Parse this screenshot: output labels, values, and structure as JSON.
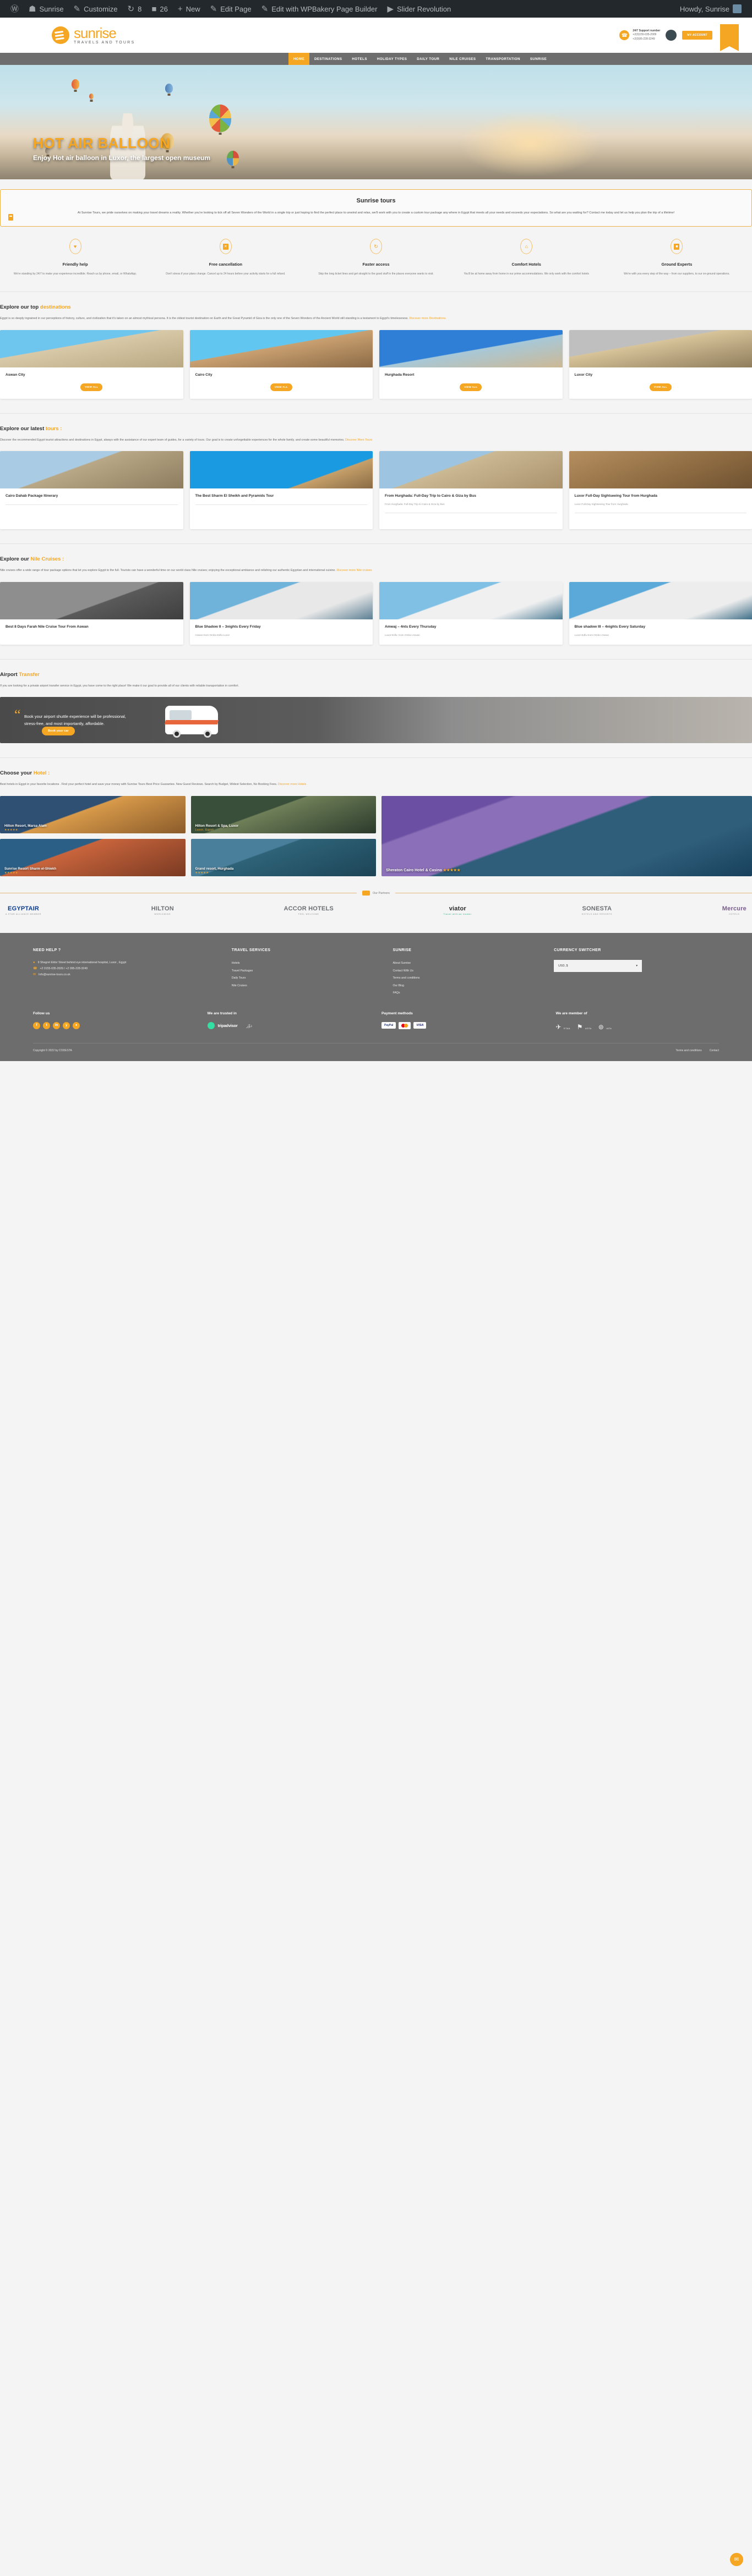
{
  "adminbar": {
    "items": [
      {
        "icon": "wordpress-icon",
        "glyph": "Ⓦ",
        "label": ""
      },
      {
        "icon": "dashboard-icon",
        "glyph": "☗",
        "label": "Sunrise"
      },
      {
        "icon": "customize-icon",
        "glyph": "✎",
        "label": "Customize"
      },
      {
        "icon": "updates-icon",
        "glyph": "↻",
        "label": "8"
      },
      {
        "icon": "comments-icon",
        "glyph": "■",
        "label": "26"
      },
      {
        "icon": "new-icon",
        "glyph": "+",
        "label": "New"
      },
      {
        "icon": "edit-page-icon",
        "glyph": "✎",
        "label": "Edit Page"
      },
      {
        "icon": "wpbakery-icon",
        "glyph": "✎",
        "label": "Edit with WPBakery Page Builder"
      },
      {
        "icon": "slider-revolution-icon",
        "glyph": "▶",
        "label": "Slider Revolution"
      }
    ],
    "howdy": "Howdy, Sunrise"
  },
  "header": {
    "logo_name": "sunrise",
    "logo_tagline": "TRAVELS AND TOURS",
    "support_label": "24/7 Support number",
    "phone1": "+2(0)155-035-2009",
    "phone2": "+2(0)95-228-3249",
    "account_button": "MY ACCOUNT"
  },
  "nav": {
    "items": [
      {
        "label": "HOME",
        "active": true
      },
      {
        "label": "DESTINATIONS",
        "active": false
      },
      {
        "label": "HOTELS",
        "active": false
      },
      {
        "label": "HOLIDAY TYPES",
        "active": false,
        "caret": true
      },
      {
        "label": "DAILY TOUR",
        "active": false,
        "caret": true
      },
      {
        "label": "NILE CRUISES",
        "active": false
      },
      {
        "label": "TRANSPORTATION",
        "active": false
      },
      {
        "label": "SUNRISE",
        "active": false,
        "caret": true
      }
    ]
  },
  "hero": {
    "title": "HOT AIR BALLOON",
    "subtitle": "Enjoy Hot air balloon in Luxor, the largest open museum"
  },
  "intro": {
    "title": "Sunrise tours",
    "body": "At Sunrise Tours, we pride ourselves on making your travel dreams a reality. Whether you're looking to tick off all Seven Wonders of the World in a single trip or just hoping to find the perfect place to unwind and relax, we'll work with you to create a custom tour package any where in Egypt that meets all your needs and exceeds your expectations. So what are you waiting for? Contact me today and let us help you plan the trip of a lifetime!"
  },
  "features": [
    {
      "icon": "heart-icon",
      "glyph": "♥",
      "title": "Friendly help",
      "text": "We're standing by 24/7 to make your experience incredible. Reach us by phone, email, or WhatsApp."
    },
    {
      "icon": "cancel-icon",
      "glyph": "✕",
      "title": "Free cancellation",
      "text": "Don't stress if your plans change. Cancel up to 24 hours before your activity starts for a full refund."
    },
    {
      "icon": "refresh-icon",
      "glyph": "↻",
      "title": "Faster access",
      "text": "Skip the long ticket lines and get straight to the good stuff in the places everyone wants to visit."
    },
    {
      "icon": "home-icon",
      "glyph": "⌂",
      "title": "Comfort Hotels",
      "text": "You'll be at home away from home in our prime accommodations. We only work with the comfort hotels"
    },
    {
      "icon": "badge-icon",
      "glyph": "■",
      "title": "Ground Experts",
      "text": "We're with you every step of the way – from our suppliers, to our on-ground operations."
    }
  ],
  "destinations_section": {
    "title_plain": "Explore our top ",
    "title_accent": "destinations",
    "desc": "Egypt is so deeply ingrained in our perceptions of history, culture, and civilization that it's taken on an almost mythical persona. It is the oldest tourist destination on Earth and the Great Pyramid of Giza is the only one of the Seven Wonders of the Ancient World still standing is a testament to Egypt's timelessness.",
    "link": "Discover more  Destinations.",
    "view_all": "VIEW ALL",
    "cards": [
      {
        "title": "Aswan City",
        "img": "aswan"
      },
      {
        "title": "Cairo City",
        "img": "cairo"
      },
      {
        "title": "Hurghada Resort",
        "img": "hurghada"
      },
      {
        "title": "Luxor City",
        "img": "luxor"
      }
    ]
  },
  "tours_section": {
    "title_plain": "Explore our latest ",
    "title_accent": "tours :",
    "desc": "Discover the recommended Egypt tourist attractions and destinations in Egypt, always with the assistance of our expert team of guides, for a variety of tours. Our goal is to create unforgettable experiences for the whole family. and create some beautiful memories.",
    "link": "Discover More Tours",
    "cards": [
      {
        "title": "Cairo Dahab Package Itinerary",
        "sub": "",
        "img": "pyramid"
      },
      {
        "title": "The Best Sharm El Sheikh and Pyramids Tour",
        "sub": "",
        "img": "mosque"
      },
      {
        "title": "From Hurghada: Full-Day Trip to Cairo & Giza by Bus",
        "sub": "From Hurghada: Full-Day Trip to Cairo & Giza by Bus",
        "img": "camels"
      },
      {
        "title": "Luxor Full-Day Sightseeing Tour from Hurghada",
        "sub": "Luxor Full-Day Sightseeing Tour from Hurghada",
        "img": "temple"
      }
    ]
  },
  "cruises_section": {
    "title_plain": "Explore our ",
    "title_accent": "Nile Cruises :",
    "desc": "Nile cruises offer a wide range of tour package options that let you explore Egypt to the full. Tourists can have a wonderful time on our world class Nile cruises; enjoying the exceptional ambiance and relishing our authentic Egyptian and international cuisine.",
    "link": "Discover more Nile cruises",
    "cards": [
      {
        "title": "Best 8 Days Farah Nile Cruise Tour From Aswan",
        "sub": "",
        "img": "c1"
      },
      {
        "title": "Blue Shadow II – 3nights Every Friday",
        "sub": "Aswan-Kom Ombo-Edfu-Luxor",
        "img": "c2"
      },
      {
        "title": "Amwaj – 4nts Every Thursday",
        "sub": "Luxor-Edfu- Kom Ombo-Aswan",
        "img": "c3"
      },
      {
        "title": "Blue shadow III – 4nights Every Saturday",
        "sub": "Luxor-Edfu-Kom Ombo-Aswan",
        "img": "c4"
      }
    ]
  },
  "airport_section": {
    "title_plain": "Airport ",
    "title_accent": "Transfer",
    "desc": "If you are looking for a private airport transfer service in Egypt, you have come to the right place! We make it our goal to provide all of our clients with reliable transportation in comfort.",
    "banner_text": "Book your airport shuttle experience will be professional, stress-free, and most importantly, affordable.",
    "banner_button": "Book your car"
  },
  "hotels_section": {
    "title_plain": "Choose your ",
    "title_accent": "Hotel :",
    "desc": "Best hotels in Egypt in your favorite locations . Find your perfect hotel and save your money with Sunrise Tours Best Price Guarantee. New Guest Reviews. Search by Budget, Widest Selection, No Booking Fees.",
    "link": "Discover more Hotels",
    "items": [
      {
        "title": "Hilton Resort, Marsa Alam",
        "stars": "★★★★★",
        "img": "h1"
      },
      {
        "title": "Hilton Resort & Spa, Luxor",
        "sub": "Luxor, Egypt",
        "stars": "",
        "img": "h2"
      },
      {
        "title": "Sunrise Resort Sharm el-Shiekh",
        "stars": "★★★★★",
        "img": "h3"
      },
      {
        "title": "Grand resort, Hurghada",
        "stars": "★★★★★",
        "img": "h4"
      },
      {
        "title": "Sheraton Cairo Hotel & Casino",
        "stars": "★★★★★",
        "img": "h5"
      }
    ]
  },
  "partners": {
    "badge": "Our Partners",
    "logos": [
      {
        "name": "EGYPTAIR",
        "sub": "A STAR ALLIANCE MEMBER"
      },
      {
        "name": "HILTON",
        "sub": "WORLDWIDE"
      },
      {
        "name": "ACCOR HOTELS",
        "sub": "FEEL WELCOME"
      },
      {
        "name": "viator",
        "sub": "Travel with an insider"
      },
      {
        "name": "SONESTA",
        "sub": "HOTELS AND RESORTS"
      },
      {
        "name": "Mercure",
        "sub": "HOTELS"
      }
    ]
  },
  "footer": {
    "need_help": {
      "title": "NEED HELP ?",
      "address": "9 Shagret Eldor Street behind eye international hospital, Luxor , Egypt",
      "phone": "+2 0155-035-2009 / +2 095-228-3249",
      "email": "Info@sunrise-tours.co.uk"
    },
    "travel_services": {
      "title": "TRAVEL SERVICES",
      "links": [
        "Hotels",
        "Travel Packages",
        "Daily Tours",
        "Nile Cruises"
      ]
    },
    "sunrise": {
      "title": "SUNRISE",
      "links": [
        "About Sunrise",
        "Contact With Us",
        "Terms and conditions",
        "Our Blog",
        "FAQs"
      ]
    },
    "currency": {
      "title": "CURRENCY SWITCHER",
      "selected": "USD, $"
    },
    "follow": {
      "title": "Follow us",
      "socials": [
        "f",
        "t",
        "in",
        "y",
        "●"
      ]
    },
    "trusted": {
      "title": "We are trusted in",
      "brand": "tripadvisor",
      "arabic": "دوّر"
    },
    "payment": {
      "title": "Payment methods",
      "methods": [
        "PayPal",
        "mastercard",
        "VISA"
      ]
    },
    "member": {
      "title": "We are member of",
      "orgs": [
        {
          "icon": "✈",
          "label": "ETAA"
        },
        {
          "icon": "⚑",
          "label": "ASTA"
        },
        {
          "icon": "⊚",
          "label": "IATA"
        }
      ]
    },
    "copyright": "Copyright © 2022 by CODESTA",
    "bottom_links": [
      "Terms and conditions",
      "Contact"
    ]
  }
}
